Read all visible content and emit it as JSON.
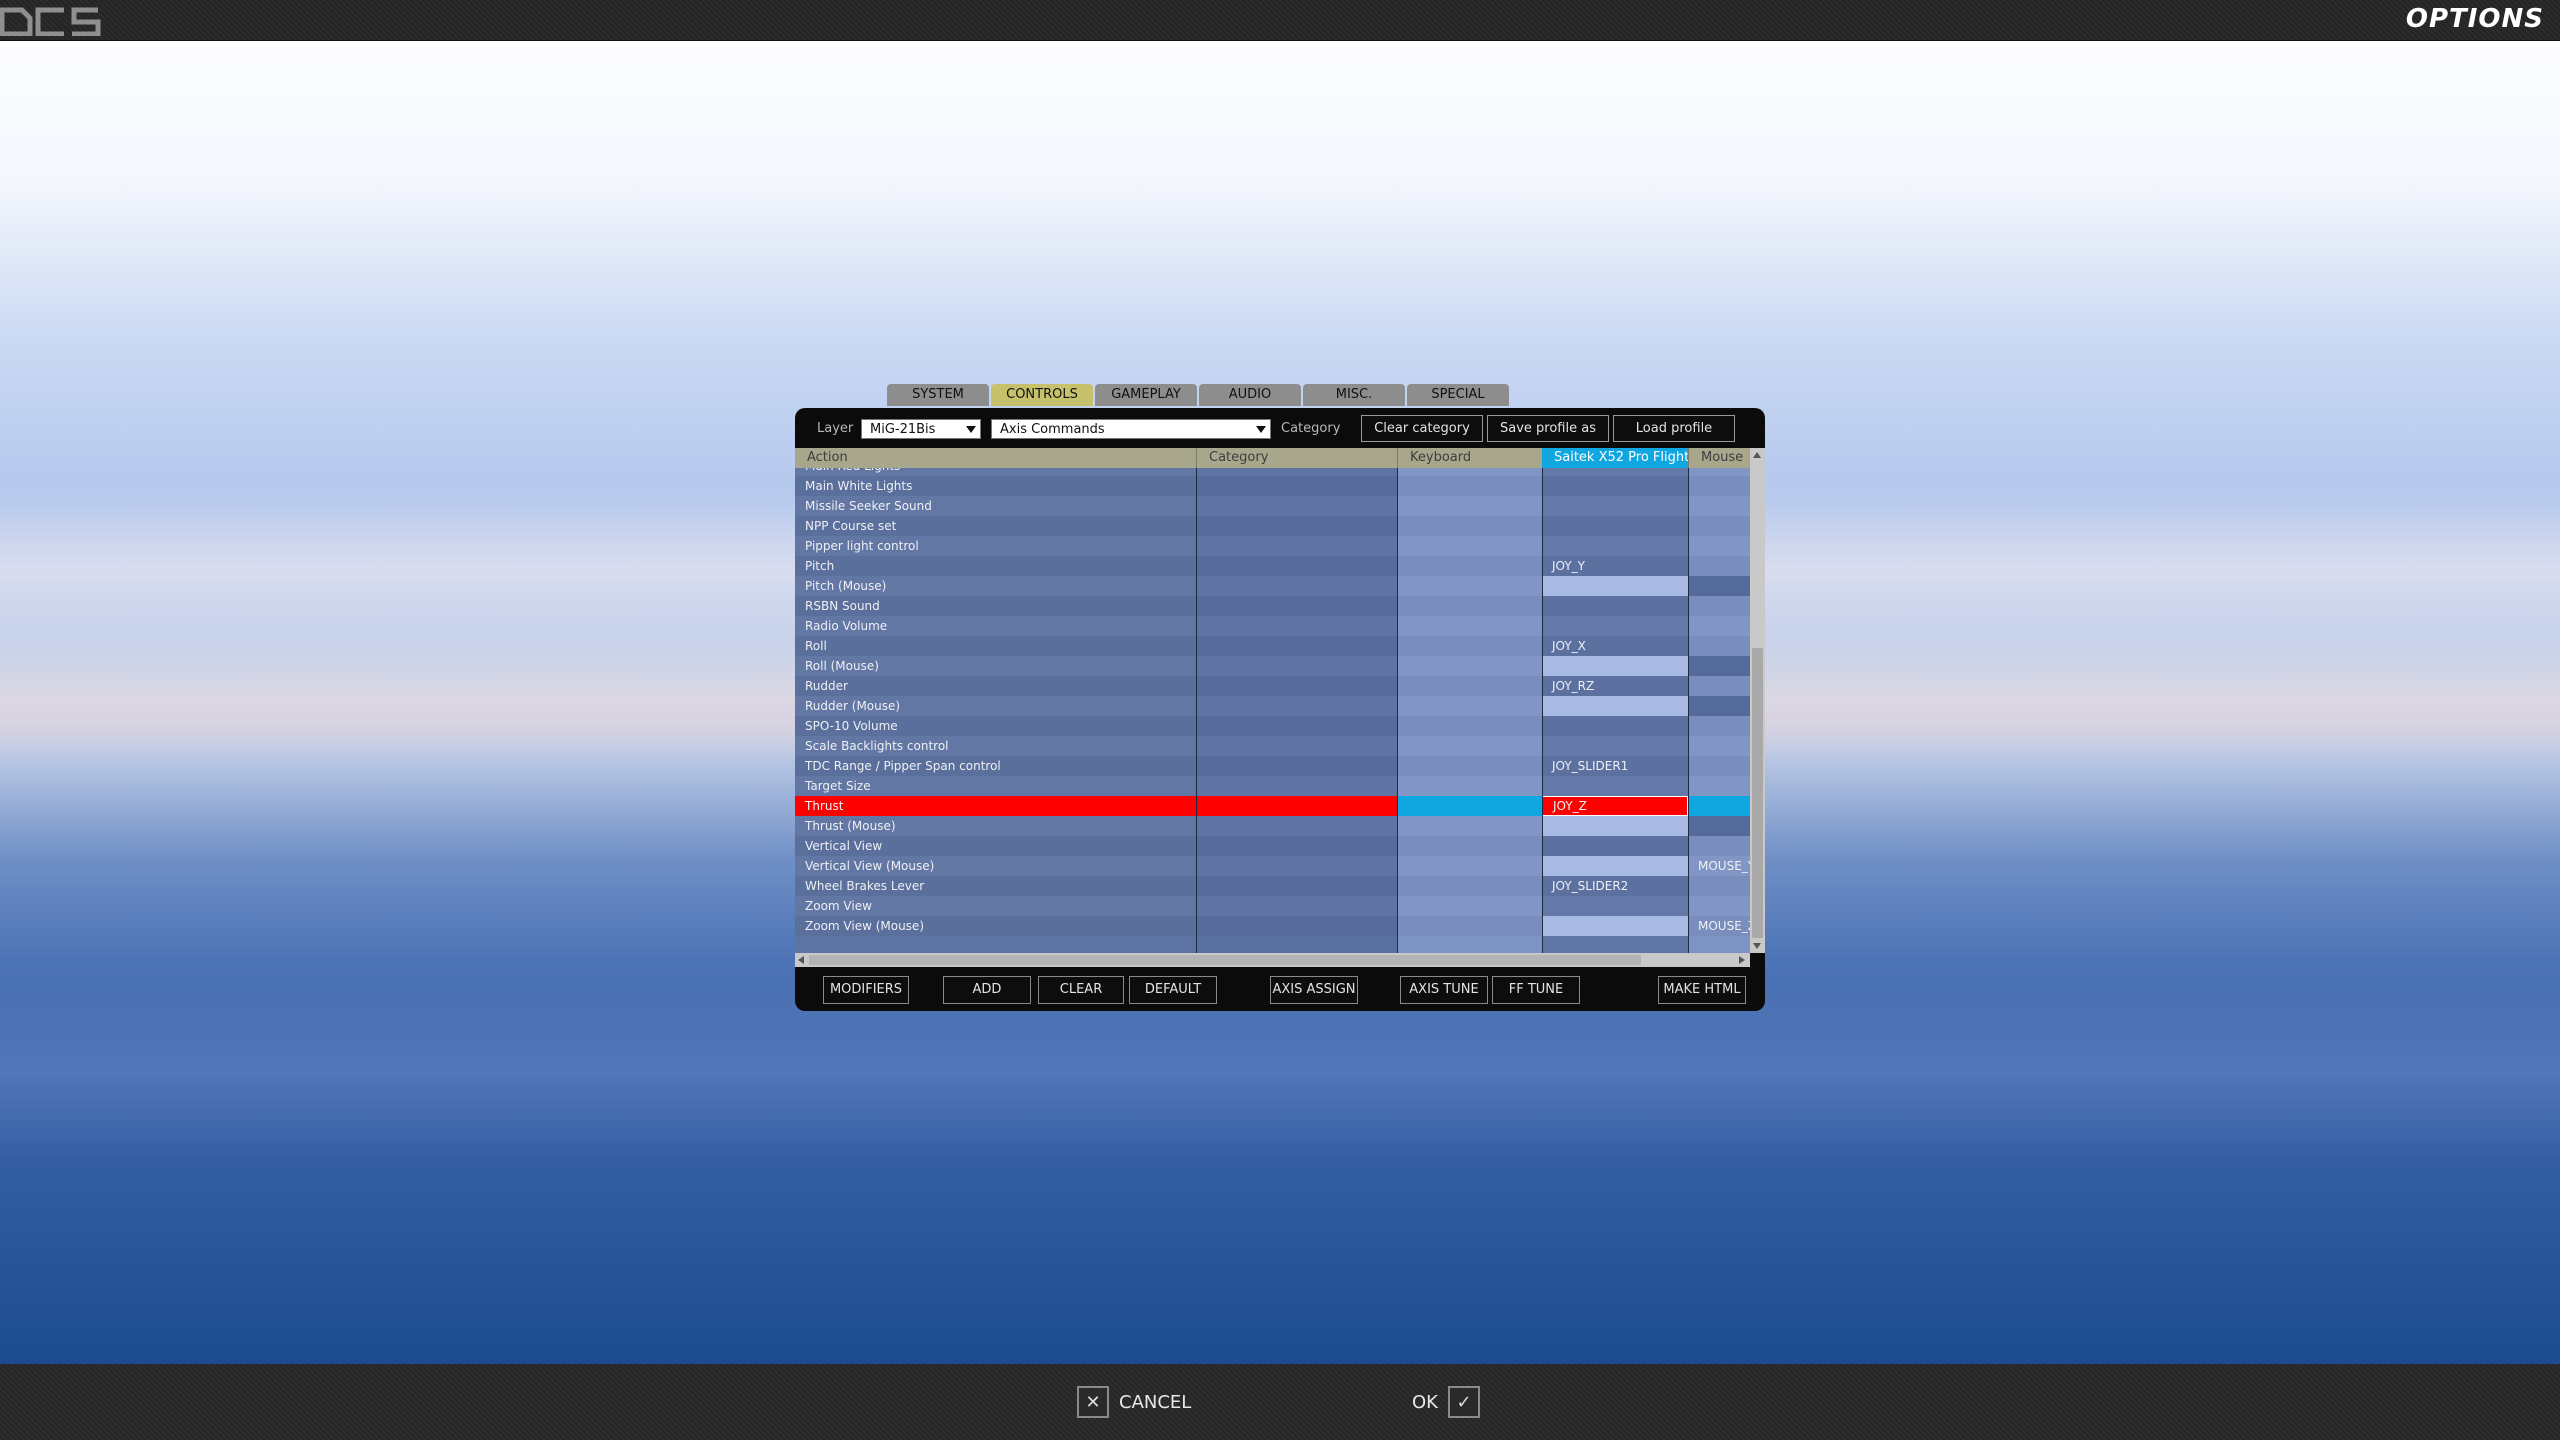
{
  "app": {
    "title": "OPTIONS"
  },
  "tabs": [
    {
      "label": "SYSTEM",
      "active": false
    },
    {
      "label": "CONTROLS",
      "active": true
    },
    {
      "label": "GAMEPLAY",
      "active": false
    },
    {
      "label": "AUDIO",
      "active": false
    },
    {
      "label": "MISC.",
      "active": false
    },
    {
      "label": "SPECIAL",
      "active": false
    }
  ],
  "toolbar": {
    "layer_label": "Layer",
    "layer_value": "MiG-21Bis",
    "category_value": "Axis Commands",
    "category_label": "Category",
    "clear_category": "Clear category",
    "save_profile": "Save profile as",
    "load_profile": "Load profile"
  },
  "grid": {
    "headers": {
      "action": "Action",
      "category": "Category",
      "keyboard": "Keyboard",
      "device": "Saitek X52 Pro Flight",
      "mouse": "Mouse"
    },
    "rows": [
      {
        "action": "Main Red Lights",
        "device": "",
        "mouse": ""
      },
      {
        "action": "Main White Lights",
        "device": "",
        "mouse": ""
      },
      {
        "action": "Missile Seeker Sound",
        "device": "",
        "mouse": ""
      },
      {
        "action": "NPP Course set",
        "device": "",
        "mouse": ""
      },
      {
        "action": "Pipper light control",
        "device": "",
        "mouse": ""
      },
      {
        "action": "Pitch",
        "device": "JOY_Y",
        "mouse": ""
      },
      {
        "action": "Pitch (Mouse)",
        "device": "",
        "mouse": ""
      },
      {
        "action": "RSBN Sound",
        "device": "",
        "mouse": ""
      },
      {
        "action": "Radio Volume",
        "device": "",
        "mouse": ""
      },
      {
        "action": "Roll",
        "device": "JOY_X",
        "mouse": ""
      },
      {
        "action": "Roll (Mouse)",
        "device": "",
        "mouse": ""
      },
      {
        "action": "Rudder",
        "device": "JOY_RZ",
        "mouse": ""
      },
      {
        "action": "Rudder (Mouse)",
        "device": "",
        "mouse": ""
      },
      {
        "action": "SPO-10 Volume",
        "device": "",
        "mouse": ""
      },
      {
        "action": "Scale Backlights control",
        "device": "",
        "mouse": ""
      },
      {
        "action": "TDC Range / Pipper Span control",
        "device": "JOY_SLIDER1",
        "mouse": ""
      },
      {
        "action": "Target Size",
        "device": "",
        "mouse": ""
      },
      {
        "action": "Thrust",
        "device": "JOY_Z",
        "mouse": "",
        "selected": true
      },
      {
        "action": "Thrust (Mouse)",
        "device": "",
        "mouse": ""
      },
      {
        "action": "Vertical View",
        "device": "",
        "mouse": ""
      },
      {
        "action": "Vertical View (Mouse)",
        "device": "",
        "mouse": "MOUSE_Y"
      },
      {
        "action": "Wheel Brakes Lever",
        "device": "JOY_SLIDER2",
        "mouse": ""
      },
      {
        "action": "Zoom View",
        "device": "",
        "mouse": ""
      },
      {
        "action": "Zoom View (Mouse)",
        "device": "",
        "mouse": "MOUSE_Z"
      }
    ]
  },
  "buttons": {
    "modifiers": "MODIFIERS",
    "add": "ADD",
    "clear": "CLEAR",
    "default": "DEFAULT",
    "axis_assign": "AXIS ASSIGN",
    "axis_tune": "AXIS TUNE",
    "ff_tune": "FF TUNE",
    "make_html": "MAKE HTML"
  },
  "footer": {
    "cancel": "CANCEL",
    "ok": "OK"
  },
  "colors": {
    "selected_row": "#ff0000",
    "device_column": "#10a6e0",
    "active_tab": "#c7c16c"
  }
}
